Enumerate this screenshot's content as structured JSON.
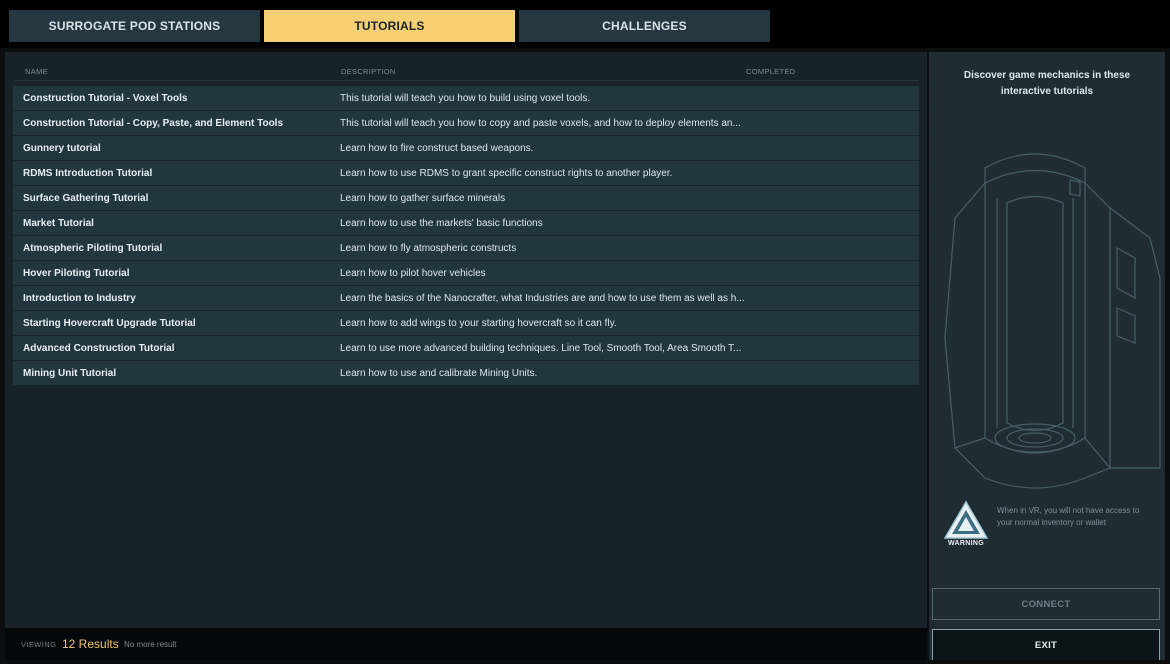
{
  "tabs": [
    {
      "label": "SURROGATE POD STATIONS",
      "active": false
    },
    {
      "label": "TUTORIALS",
      "active": true
    },
    {
      "label": "CHALLENGES",
      "active": false
    }
  ],
  "table": {
    "columns": {
      "name": "NAME",
      "description": "DESCRIPTION",
      "completed": "COMPLETED"
    },
    "rows": [
      {
        "name": "Construction Tutorial - Voxel Tools",
        "description": "This tutorial will teach you how to build using voxel tools."
      },
      {
        "name": "Construction Tutorial - Copy, Paste, and Element Tools",
        "description": "This tutorial will teach you how to copy and paste voxels, and how to deploy elements an..."
      },
      {
        "name": "Gunnery tutorial",
        "description": "Learn how to fire construct based weapons."
      },
      {
        "name": "RDMS Introduction Tutorial",
        "description": "Learn how to use RDMS to grant specific construct rights to another player."
      },
      {
        "name": "Surface Gathering Tutorial",
        "description": "Learn how to gather surface minerals"
      },
      {
        "name": "Market Tutorial",
        "description": "Learn how to use the markets' basic functions"
      },
      {
        "name": "Atmospheric Piloting Tutorial",
        "description": "Learn how to fly atmospheric constructs"
      },
      {
        "name": "Hover Piloting Tutorial",
        "description": "Learn how to pilot hover vehicles"
      },
      {
        "name": "Introduction to Industry",
        "description": "Learn the basics of the Nanocrafter, what Industries are and how to use them as well as h..."
      },
      {
        "name": "Starting Hovercraft Upgrade Tutorial",
        "description": "Learn how to add wings to your starting hovercraft so it can fly."
      },
      {
        "name": "Advanced Construction Tutorial",
        "description": "Learn to use more advanced building techniques. Line Tool, Smooth Tool, Area Smooth T..."
      },
      {
        "name": "Mining Unit Tutorial",
        "description": "Learn how to use and calibrate Mining Units."
      }
    ]
  },
  "footer": {
    "viewing_label": "VIEWING",
    "count": "12 Results",
    "no_more": "No more result"
  },
  "side": {
    "description": "Discover game mechanics in these interactive tutorials",
    "warning_badge": "WARNING",
    "warning_text": "When in VR, you will not have access to your normal inventory or wallet",
    "connect_label": "CONNECT",
    "exit_label": "EXIT"
  },
  "colors": {
    "accent": "#f7cf73",
    "row_bg": "#22363e",
    "panel_bg": "#172229",
    "side_bg": "#1f2d33"
  }
}
